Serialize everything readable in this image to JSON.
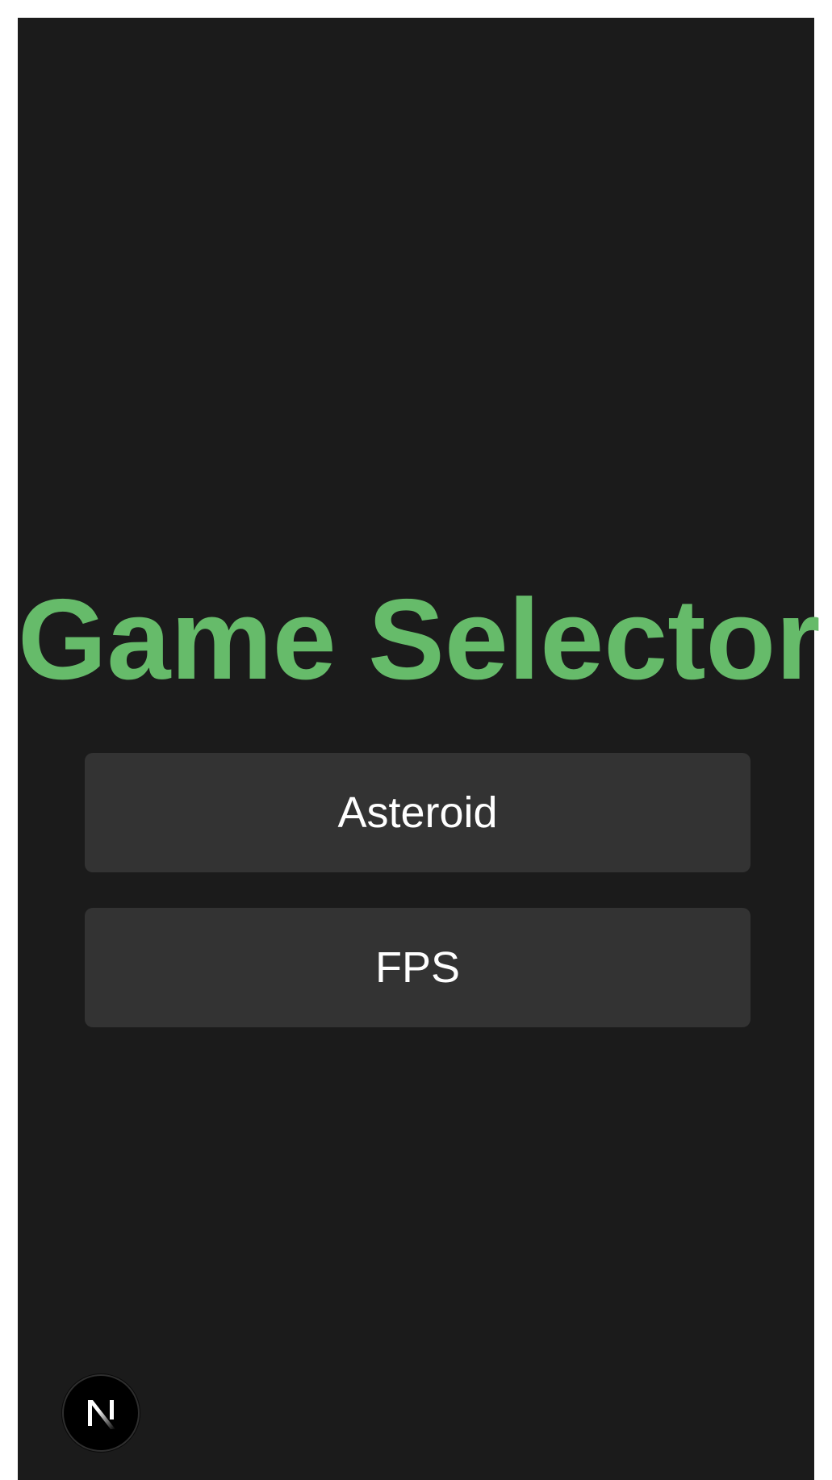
{
  "page": {
    "title": "Game Selector"
  },
  "games": {
    "items": [
      {
        "label": "Asteroid"
      },
      {
        "label": "FPS"
      }
    ]
  },
  "badge": {
    "icon": "nextjs-logo-icon"
  },
  "colors": {
    "background": "#1b1b1b",
    "title": "#66bb6a",
    "button": "#333333",
    "button_text": "#ffffff"
  }
}
